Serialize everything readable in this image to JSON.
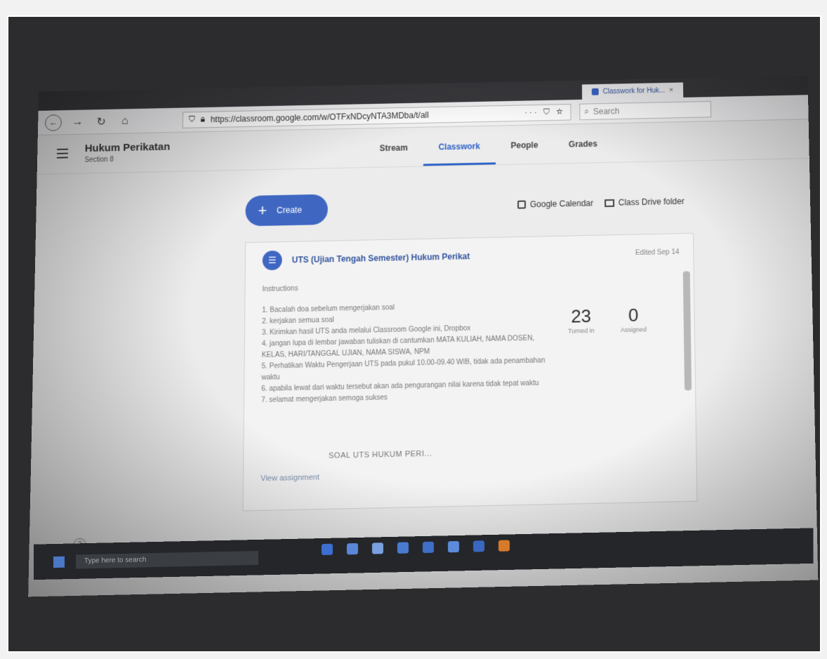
{
  "browser": {
    "tabs": [
      "",
      "",
      "",
      "",
      ""
    ],
    "active_tab": "Classwork for Huk...",
    "active_tab_close": "×",
    "url": "https://classroom.google.com/w/OTFxNDcyNTA3MDba/t/all",
    "url_actions": "··· ⛉ ☆",
    "search_placeholder": "Search"
  },
  "classroom": {
    "class_name": "Hukum Perikatan",
    "section": "Section 8",
    "tabs": [
      "Stream",
      "Classwork",
      "People",
      "Grades"
    ],
    "active_tab_index": 1
  },
  "toolbar": {
    "create_label": "Create",
    "create_icon": "+",
    "calendar_label": "Google Calendar",
    "drive_label": "Class Drive folder"
  },
  "assignment": {
    "title": "UTS (Ujian Tengah Semester) Hukum Perikat",
    "date": "Edited Sep 14",
    "instructions_heading": "Instructions",
    "instructions": [
      "1. Bacalah doa sebelum mengerjakan soal",
      "2. kerjakan semua soal",
      "3. Kirimkan hasil UTS anda melalui Classroom Google ini, Dropbox",
      "4. jangan lupa di lembar jawaban tuliskan di cantumkan MATA KULIAH, NAMA DOSEN, KELAS, HARI/TANGGAL UJIAN, NAMA SISWA, NPM",
      "5. Perhatikan Waktu Pengerjaan UTS pada pukul 10.00-09.40 WIB, tidak ada penambahan waktu",
      "6. apabila lewat dari waktu tersebut akan ada pengurangan nilai karena tidak tepat waktu",
      "7. selamat mengerjakan semoga sukses"
    ],
    "turned_in_count": "23",
    "turned_in_label": "Turned in",
    "assigned_count": "0",
    "assigned_label": "Assigned",
    "attachment": "SOAL UTS HUKUM PERI...",
    "view_link": "View assignment"
  },
  "help_icon": "?",
  "taskbar": {
    "search_placeholder": "Type here to search"
  },
  "colors": {
    "accent": "#3f67c2",
    "active_tab": "#2d63c8"
  }
}
